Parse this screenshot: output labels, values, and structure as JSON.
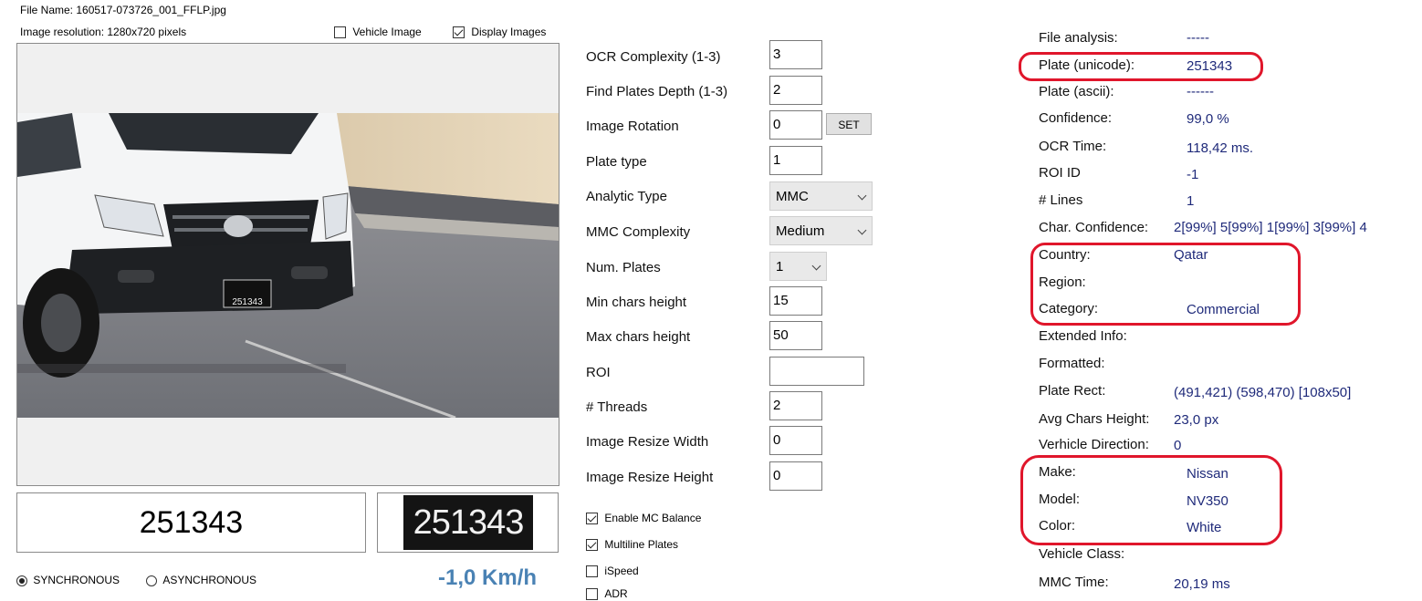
{
  "header": {
    "file_name": "File Name: 160517-073726_001_FFLP.jpg",
    "image_resolution": "Image resolution: 1280x720 pixels",
    "vehicle_image_label": "Vehicle Image",
    "vehicle_image_checked": false,
    "display_images_label": "Display Images",
    "display_images_checked": true
  },
  "image_panel": {
    "plate_in_image": "251343"
  },
  "result": {
    "plate_text": "251343",
    "plate_thumb_text": "251343",
    "speed": "-1,0 Km/h"
  },
  "mode": {
    "sync_label": "SYNCHRONOUS",
    "async_label": "ASYNCHRONOUS",
    "selected": "SYNCHRONOUS"
  },
  "settings": {
    "ocr_complexity": {
      "label": "OCR Complexity (1-3)",
      "value": "3"
    },
    "find_plates_depth": {
      "label": "Find Plates Depth (1-3)",
      "value": "2"
    },
    "image_rotation": {
      "label": "Image Rotation",
      "value": "0",
      "button": "SET"
    },
    "plate_type": {
      "label": "Plate type",
      "value": "1"
    },
    "analytic_type": {
      "label": "Analytic Type",
      "value": "MMC"
    },
    "mmc_complexity": {
      "label": "MMC Complexity",
      "value": "Medium"
    },
    "num_plates": {
      "label": "Num. Plates",
      "value": "1"
    },
    "min_chars_height": {
      "label": "Min chars height",
      "value": "15"
    },
    "max_chars_height": {
      "label": "Max chars height",
      "value": "50"
    },
    "roi": {
      "label": "ROI",
      "value": ""
    },
    "threads": {
      "label": "# Threads",
      "value": "2"
    },
    "resize_width": {
      "label": "Image Resize Width",
      "value": "0"
    },
    "resize_height": {
      "label": "Image Resize Height",
      "value": "0"
    }
  },
  "options": {
    "enable_mc_balance": {
      "label": "Enable MC Balance",
      "checked": true
    },
    "multiline_plates": {
      "label": "Multiline Plates",
      "checked": true
    },
    "ispeed": {
      "label": "iSpeed",
      "checked": false
    },
    "adr": {
      "label": "ADR",
      "checked": false
    }
  },
  "info": {
    "file_analysis": {
      "label": "File analysis:",
      "value": "-----"
    },
    "plate_unicode": {
      "label": "Plate (unicode):",
      "value": "251343"
    },
    "plate_ascii": {
      "label": "Plate (ascii):",
      "value": "------"
    },
    "confidence": {
      "label": "Confidence:",
      "value": "99,0 %"
    },
    "ocr_time": {
      "label": "OCR Time:",
      "value": "118,42 ms."
    },
    "roi_id": {
      "label": "ROI ID",
      "value": "-1"
    },
    "lines": {
      "label": "# Lines",
      "value": "1"
    },
    "char_confidence": {
      "label": "Char. Confidence:",
      "value": "2[99%] 5[99%] 1[99%] 3[99%] 4"
    },
    "country": {
      "label": "Country:",
      "value": "Qatar"
    },
    "region": {
      "label": "Region:",
      "value": ""
    },
    "category": {
      "label": "Category:",
      "value": "Commercial"
    },
    "extended_info": {
      "label": "Extended Info:",
      "value": ""
    },
    "formatted": {
      "label": "Formatted:",
      "value": ""
    },
    "plate_rect": {
      "label": "Plate Rect:",
      "value": "(491,421) (598,470) [108x50]"
    },
    "avg_chars_height": {
      "label": "Avg Chars Height:",
      "value": "23,0 px"
    },
    "vehicle_direction": {
      "label": "Verhicle Direction:",
      "value": "0"
    },
    "make": {
      "label": "Make:",
      "value": "Nissan"
    },
    "model": {
      "label": "Model:",
      "value": "NV350"
    },
    "color": {
      "label": "Color:",
      "value": "White"
    },
    "vehicle_class": {
      "label": "Vehicle Class:",
      "value": ""
    },
    "mmc_time": {
      "label": "MMC Time:",
      "value": "20,19 ms"
    }
  },
  "colors": {
    "highlight_red": "#e0162b",
    "value_blue": "#1f2a7a",
    "speed_blue": "#4a82b4"
  }
}
